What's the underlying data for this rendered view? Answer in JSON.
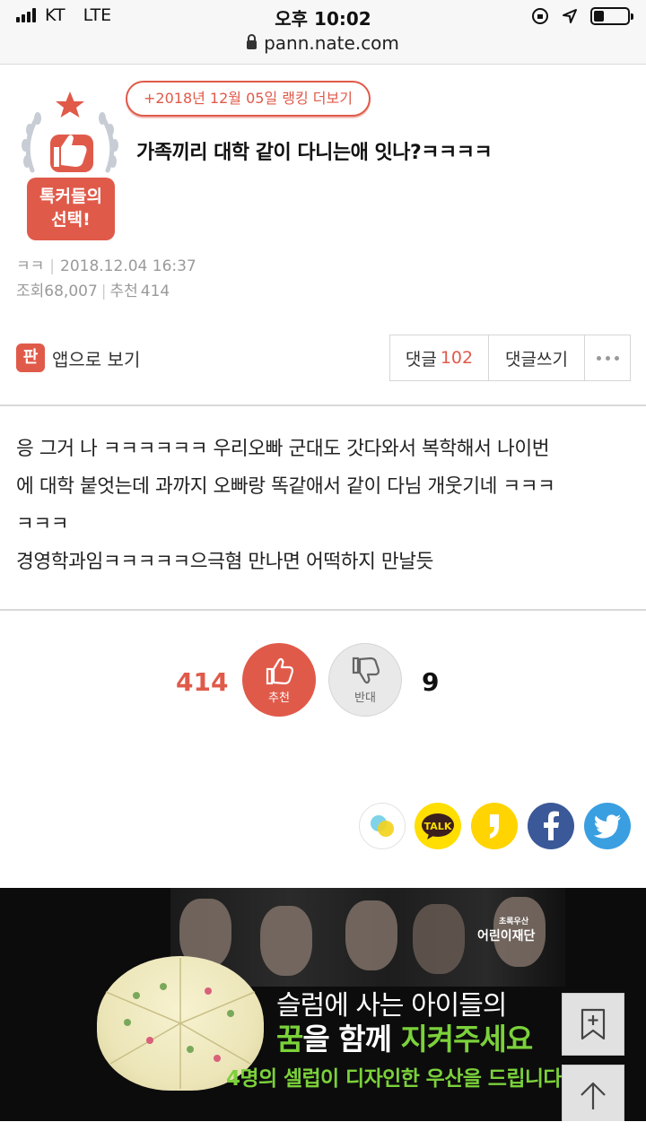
{
  "status_bar": {
    "carrier": "KT",
    "network": "LTE",
    "time": "오후 10:02",
    "url": "pann.nate.com",
    "battery_level": 0.3
  },
  "badge": {
    "line1": "톡커들의",
    "line2": "선택!"
  },
  "post": {
    "ranking_link": "+2018년 12월 05일 랭킹 더보기",
    "title": "가족끼리 대학 같이 다니는애 잇나?ㅋㅋㅋㅋ",
    "author": "ㅋㅋ",
    "date": "2018.12.04 16:37",
    "views_label": "조회",
    "views": "68,007",
    "recommend_label": "추천",
    "recommend": "414",
    "body": [
      "응 그거 나 ㅋㅋㅋㅋㅋㅋ 우리오빠 군대도 갓다와서 복학해서 나이번",
      "에 대학 붙엇는데 과까지 오빠랑 똑같애서 같이 다님 개웃기네 ㅋㅋㅋ",
      "ㅋㅋㅋ",
      "경영학과임ㅋㅋㅋㅋㅋ으극혐 만나면 어떡하지 만날듯"
    ]
  },
  "actions": {
    "app_icon_text": "판",
    "app_view": "앱으로 보기",
    "comments_label": "댓글",
    "comments_count": "102",
    "write_comment": "댓글쓰기"
  },
  "votes": {
    "up_count": "414",
    "up_label": "추천",
    "down_label": "반대",
    "down_count": "9"
  },
  "share": {
    "kakaotalk_label": "TALK"
  },
  "banner": {
    "foundation_small": "초록우산",
    "foundation": "어린이재단",
    "line1": "슬럼에 사는 아이들의",
    "line2_a": "꿈",
    "line2_b": "을 함께 ",
    "line2_c": "지켜주세요",
    "line3": "4명의 셀럽이 디자인한 우산을 드립니다"
  },
  "colors": {
    "accent": "#e05a4a",
    "banner_green": "#7bd13a",
    "facebook": "#3b5998",
    "twitter": "#3a9fe0",
    "kakao": "#ffde00"
  }
}
